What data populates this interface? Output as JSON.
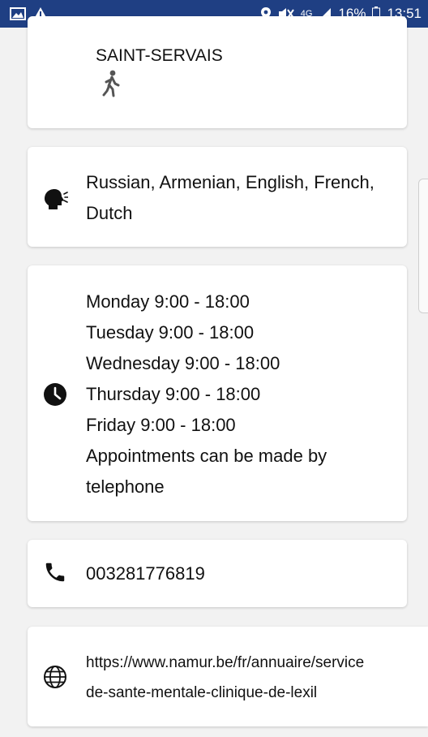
{
  "status_bar": {
    "left_icons": [
      "image-icon",
      "warning-icon"
    ],
    "network": "4G",
    "battery": "16%",
    "time": "13:51"
  },
  "address": {
    "city": "SAINT-SERVAIS",
    "icon": "walking-person-icon"
  },
  "languages": {
    "icon": "speaking-head-icon",
    "text": "Russian, Armenian, English, French, Dutch"
  },
  "hours": {
    "icon": "clock-icon",
    "lines": [
      "Monday 9:00 - 18:00",
      "Tuesday 9:00 - 18:00",
      "Wednesday 9:00 - 18:00",
      "Thursday 9:00 - 18:00",
      "Friday 9:00 - 18:00",
      "Appointments can be made by",
      "telephone"
    ]
  },
  "phone": {
    "icon": "phone-icon",
    "number": "003281776819"
  },
  "website": {
    "icon": "globe-icon",
    "line1": "https://www.namur.be/fr/annuaire/service",
    "line2": "de-sante-mentale-clinique-de-lexil"
  },
  "colors": {
    "status_bar": "#1f3f83",
    "background": "#f2f2f2",
    "card": "#ffffff"
  }
}
